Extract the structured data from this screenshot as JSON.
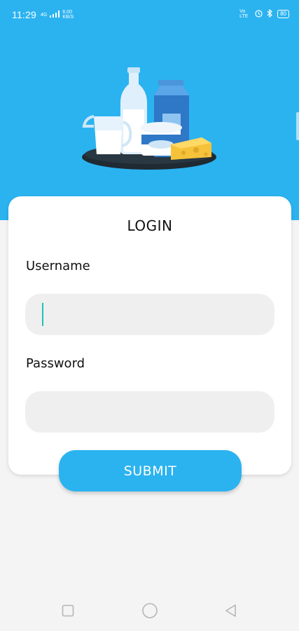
{
  "status_bar": {
    "time": "11:29",
    "signal_left": "4G",
    "speed_value": "6.00",
    "speed_unit": "KB/S",
    "volte": "Vo LTE",
    "battery": "80"
  },
  "colors": {
    "brand": "#2bb3f0",
    "card": "#ffffff",
    "input_bg": "#efefef",
    "cursor": "#1cc2b8"
  },
  "hero": {
    "illustration": "dairy-products-icon"
  },
  "login": {
    "title": "LOGIN",
    "username_label": "Username",
    "username_value": "",
    "password_label": "Password",
    "password_value": "",
    "submit_label": "SUBMIT"
  },
  "nav": {
    "recent": "square-icon",
    "home": "circle-icon",
    "back": "triangle-back-icon"
  }
}
